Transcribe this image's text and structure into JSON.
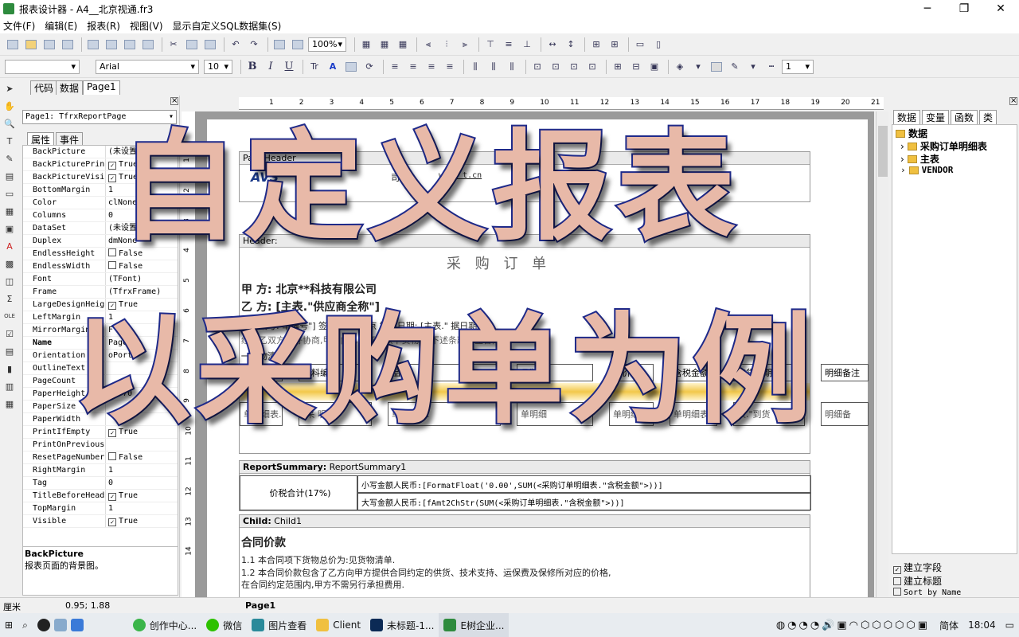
{
  "window": {
    "title": "报表设计器 - A4__北京视通.fr3",
    "minimize": "─",
    "maximize": "❐",
    "close": "✕"
  },
  "menu": [
    "文件(F)",
    "编辑(E)",
    "报表(R)",
    "视图(V)",
    "显示自定义SQL数据集(S)"
  ],
  "toolbar": {
    "zoom": "100%",
    "font_name": "Arial",
    "font_size": "10",
    "line_width": "1",
    "bold": "B",
    "italic": "I",
    "underline": "U"
  },
  "tabs": [
    "代码",
    "数据",
    "Page1"
  ],
  "inspector": {
    "object": "Page1: TfrxReportPage",
    "tabs": [
      "属性",
      "事件"
    ],
    "properties": [
      {
        "name": "BackPicture",
        "value": "(未设置)"
      },
      {
        "name": "BackPicturePrin",
        "value": "True",
        "check": true
      },
      {
        "name": "BackPictureVisi",
        "value": "True",
        "check": true
      },
      {
        "name": "BottomMargin",
        "value": "1"
      },
      {
        "name": "Color",
        "value": "clNone"
      },
      {
        "name": "Columns",
        "value": "0"
      },
      {
        "name": "DataSet",
        "value": "(未设置)"
      },
      {
        "name": "Duplex",
        "value": "dmNone"
      },
      {
        "name": "EndlessHeight",
        "value": "False",
        "check": false
      },
      {
        "name": "EndlessWidth",
        "value": "False",
        "check": false
      },
      {
        "name": "Font",
        "value": "(TFont)"
      },
      {
        "name": "Frame",
        "value": "(TfrxFrame)"
      },
      {
        "name": "LargeDesignHeig",
        "value": "True",
        "check": true
      },
      {
        "name": "LeftMargin",
        "value": "1"
      },
      {
        "name": "MirrorMargins",
        "value": "F"
      },
      {
        "name": "Name",
        "value": "Page1"
      },
      {
        "name": "Orientation",
        "value": "oPortr"
      },
      {
        "name": "OutlineText",
        "value": ""
      },
      {
        "name": "PageCount",
        "value": ""
      },
      {
        "name": "PaperHeight",
        "value": "29.70"
      },
      {
        "name": "PaperSize",
        "value": ""
      },
      {
        "name": "PaperWidth",
        "value": ""
      },
      {
        "name": "PrintIfEmpty",
        "value": "True",
        "check": true
      },
      {
        "name": "PrintOnPrevious",
        "value": ""
      },
      {
        "name": "ResetPageNumber",
        "value": "False",
        "check": false
      },
      {
        "name": "RightMargin",
        "value": "1"
      },
      {
        "name": "Tag",
        "value": "0"
      },
      {
        "name": "TitleBeforeHead",
        "value": "True",
        "check": true
      },
      {
        "name": "TopMargin",
        "value": "1"
      },
      {
        "name": "Visible",
        "value": "True",
        "check": true
      }
    ],
    "desc_title": "BackPicture",
    "desc_text": "报表页面的背景图。"
  },
  "ruler_ticks": [
    "1",
    "2",
    "3",
    "4",
    "5",
    "6",
    "7",
    "8",
    "9",
    "10",
    "11",
    "12",
    "13",
    "14",
    "15",
    "16",
    "17",
    "18",
    "19",
    "20",
    "21"
  ],
  "vruler_ticks": [
    "1",
    "2",
    "3",
    "4",
    "5",
    "6",
    "7",
    "8",
    "9",
    "10",
    "11",
    "12",
    "13",
    "14"
  ],
  "report": {
    "page_header": "PageHeader",
    "logo": "AVS",
    "company_suffix": "司",
    "website": "www.    t.cn",
    "header_label": "Header:",
    "header_title": "采  购    订    单",
    "party_a": "甲    方: 北京**科技有限公司",
    "party_b": "乙    方: [主表.\"供应商全称\"]",
    "contract_line": "合同编号:    单编号\"]    签订地点: 北京            签订日期: [主表.\"    据日期\"]",
    "intro_line": "经甲乙双方友好协商,甲方向乙方订购以下货物,按下述条款订立合同:",
    "goods_title": "一、物清单",
    "columns": [
      "序号",
      "物料编码",
      "品名",
      "品牌",
      "单价",
      "含税金额",
      "交货日期",
      "明细备注"
    ],
    "detail_row": [
      "单明细表.",
      "[采    明细",
      "单明细表.",
      "单明细",
      "单明细表.",
      "单明细表",
      "表.\"到货",
      "明细备"
    ],
    "summary_label": "ReportSummary:",
    "summary_name": "ReportSummary1",
    "tax_total_label": "价税合计(17%)",
    "amount_small": "小写金额人民币:[FormatFloat('0.00',SUM(<采购订单明细表.\"含税金额\">))]",
    "amount_big": "大写金额人民币:[fAmt2ChStr(SUM(<采购订单明细表.\"含税金额\">))]",
    "child_label": "Child:",
    "child_name": "Child1",
    "price_title": "合同价款",
    "clause1": "1.1  本合同项下货物总价为:见货物清单.",
    "clause2": "1.2  本合同价款包含了乙方向甲方提供合同约定的供货、技术支持、运保费及保修所对应的价格,",
    "clause2b": "     在合同约定范围内,甲方不需另行承担费用."
  },
  "right_panel": {
    "tabs": [
      "数据",
      "变量",
      "函数",
      "类"
    ],
    "root": "数据",
    "items": [
      "采购订单明细表",
      "主表",
      "VENDOR"
    ],
    "options": [
      {
        "label": "建立字段",
        "checked": true
      },
      {
        "label": "建立标题",
        "checked": false
      },
      {
        "label": "Sort by Name",
        "checked": false
      }
    ]
  },
  "status": {
    "unit": "厘米",
    "coords": "0.95; 1.88",
    "page": "Page1"
  },
  "overlay": {
    "line1": "自定义报表",
    "line2": "以采购单为例"
  },
  "taskbar": {
    "items": [
      "创作中心...",
      "微信",
      "图片查看",
      "Client",
      "未标题-1...",
      "E树企业..."
    ],
    "lang": "简体",
    "time": "18:04"
  }
}
